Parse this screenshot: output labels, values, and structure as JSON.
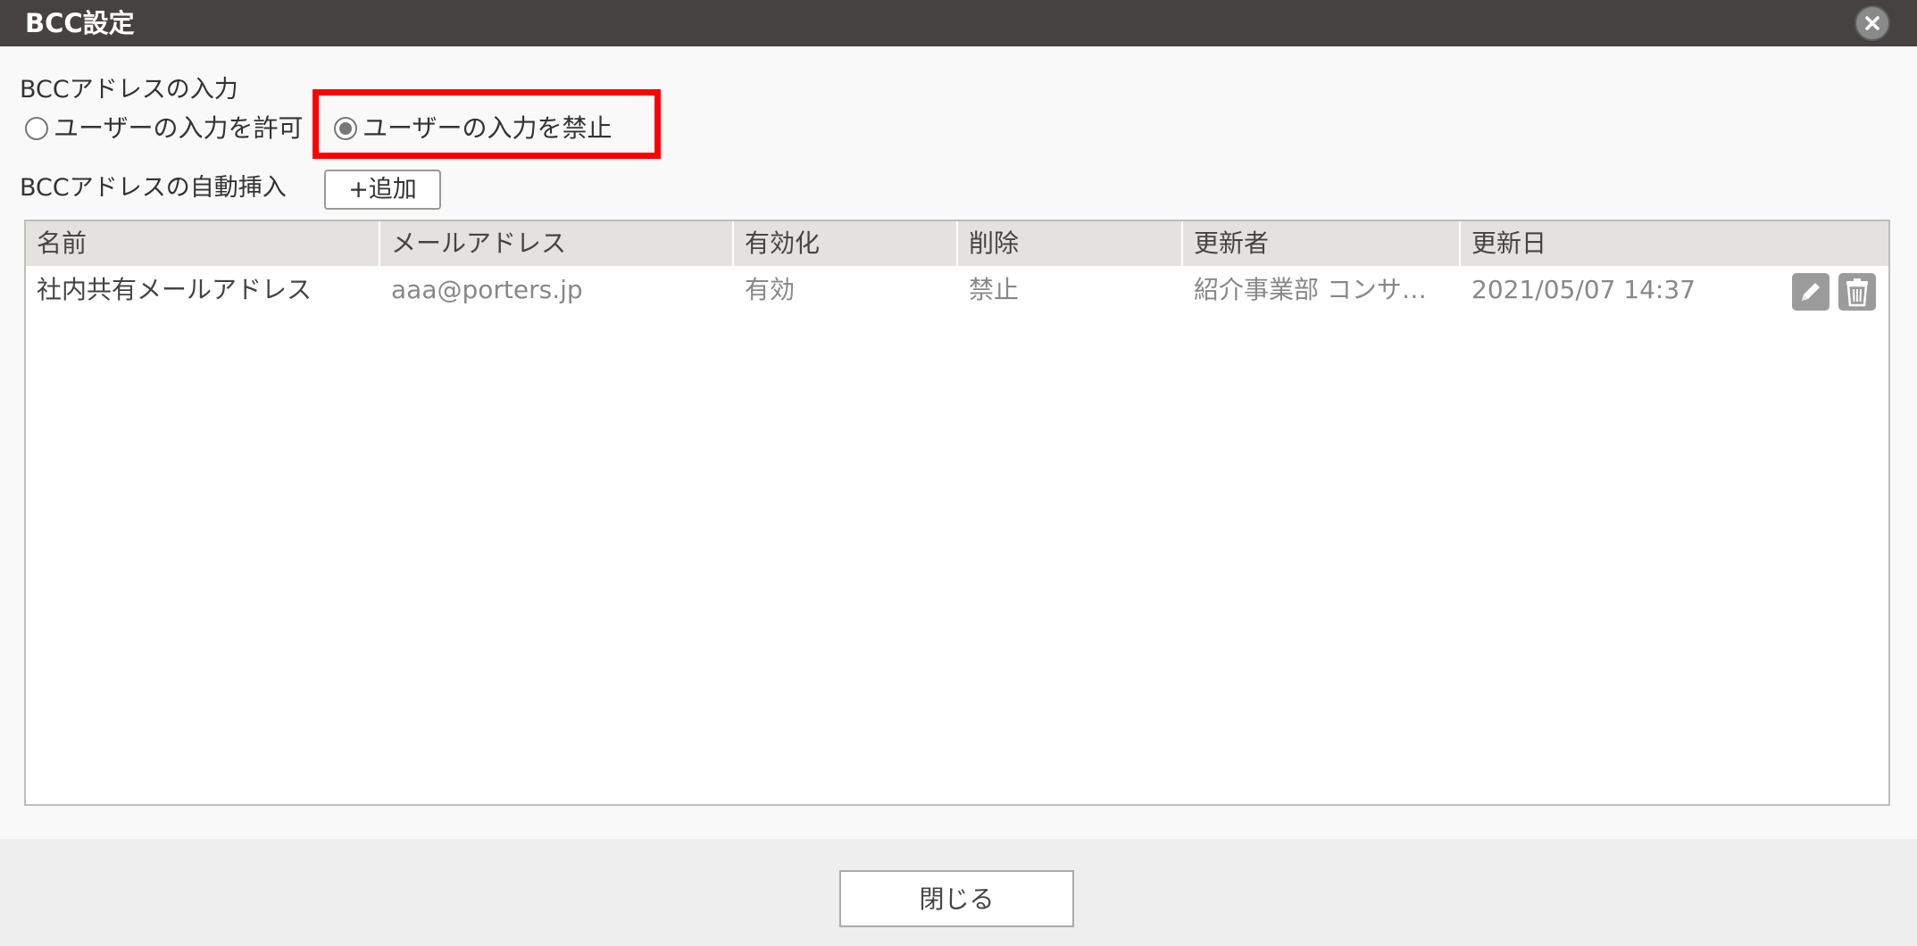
{
  "window": {
    "title": "BCC設定",
    "close_icon": "close-icon"
  },
  "bcc_input": {
    "label": "BCCアドレスの入力",
    "options": [
      {
        "label": "ユーザーの入力を許可",
        "checked": false
      },
      {
        "label": "ユーザーの入力を禁止",
        "checked": true
      }
    ],
    "highlight_color": "#ff0000"
  },
  "auto_insert": {
    "label": "BCCアドレスの自動挿入",
    "add_label": "+追加"
  },
  "table": {
    "columns": [
      "名前",
      "メールアドレス",
      "有効化",
      "削除",
      "更新者",
      "更新日"
    ],
    "rows": [
      {
        "name": "社内共有メールアドレス",
        "email": "aaa@porters.jp",
        "enabled": "有効",
        "delete": "禁止",
        "updated_by": "紹介事業部 コンサ…",
        "updated_at": "2021/05/07 14:37",
        "actions": [
          "pencil-icon",
          "trash-icon"
        ]
      }
    ]
  },
  "footer": {
    "close_label": "閉じる"
  }
}
